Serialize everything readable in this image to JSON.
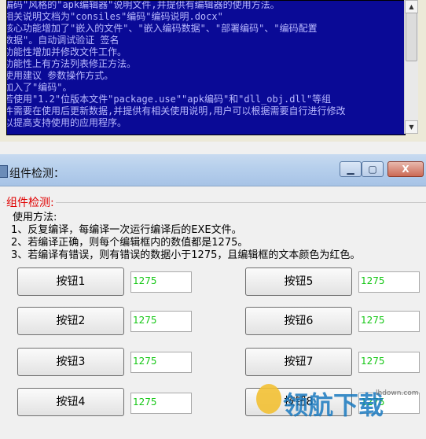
{
  "console": {
    "lines": [
      "编码\"风格的\"apk编辑器\"说明文件,并提供有编辑器的使用方法。",
      "相关说明文档为\"consiles\"编码\"编码说明.docx\"",
      "  核心功能增加了\"嵌入的文件\"、\"嵌入编码数据\"、\"部署编码\"、\"编码配置",
      "数据\"。自动调试验证 签名",
      "  功能性增加并修改文件工作。",
      "  功能性上有方法列表修正方法。",
      "  使用建议 参数操作方式。",
      "  加入了\"编码\"。",
      "  若使用\"1.2\"位版本文件\"package.use\"\"apk编码\"和\"dll_obj.dll\"等组",
      "件需要在使用后更新数据,并提供有相关使用说明,用户可以根据需要自行进行修改",
      "以提高支持使用的应用程序。"
    ]
  },
  "window": {
    "title": "组件检测：",
    "min_glyph": "▁",
    "max_glyph": "▢",
    "close_glyph": "X"
  },
  "group": {
    "label": "组件检测:",
    "usage_title": "使用方法:",
    "step1": "1、反复编译，每编译一次运行编译后的EXE文件。",
    "step2": "2、若编译正确，则每个编辑框内的数值都是1275。",
    "step3": "3、若编译有错误，则有错误的数据小于1275，且编辑框的文本颜色为红色。"
  },
  "buttons": [
    {
      "label": "按钮1",
      "value": "1275"
    },
    {
      "label": "按钮2",
      "value": "1275"
    },
    {
      "label": "按钮3",
      "value": "1275"
    },
    {
      "label": "按钮4",
      "value": "1275"
    },
    {
      "label": "按钮5",
      "value": "1275"
    },
    {
      "label": "按钮6",
      "value": "1275"
    },
    {
      "label": "按钮7",
      "value": "1275"
    },
    {
      "label": "按钮8",
      "value": "1275"
    }
  ],
  "watermark": {
    "text": "领航下载",
    "url": "lhdown.com"
  },
  "colors": {
    "console_bg": "#0a0a96",
    "value_text": "#15c715",
    "group_label": "#e00000"
  }
}
